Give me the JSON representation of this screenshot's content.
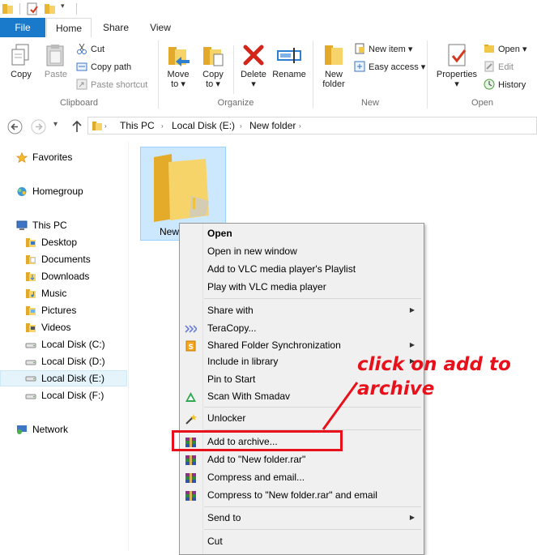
{
  "ribbon_tabs": [
    "File",
    "Home",
    "Share",
    "View"
  ],
  "clipboard": {
    "copy": "Copy",
    "paste": "Paste",
    "cut": "Cut",
    "copy_path": "Copy path",
    "paste_shortcut": "Paste shortcut",
    "group": "Clipboard"
  },
  "organize": {
    "move_to": [
      "Move",
      "to ▾"
    ],
    "copy_to": [
      "Copy",
      "to ▾"
    ],
    "delete": [
      "Delete",
      "▾"
    ],
    "rename": "Rename",
    "group": "Organize"
  },
  "new_group": {
    "new_folder": [
      "New",
      "folder"
    ],
    "new_item": "New item ▾",
    "easy_access": "Easy access ▾",
    "group": "New"
  },
  "open_group": {
    "properties": [
      "Properties",
      "▾"
    ],
    "open": "Open ▾",
    "edit": "Edit",
    "history": "History",
    "group": "Open"
  },
  "address": {
    "crumbs": [
      "This PC",
      "Local Disk (E:)",
      "New folder"
    ]
  },
  "nav": {
    "favorites": "Favorites",
    "homegroup": "Homegroup",
    "this_pc": "This PC",
    "items": [
      "Desktop",
      "Documents",
      "Downloads",
      "Music",
      "Pictures",
      "Videos",
      "Local Disk (C:)",
      "Local Disk (D:)",
      "Local Disk (E:)",
      "Local Disk (F:)"
    ],
    "network": "Network"
  },
  "folder_label": "New",
  "context_menu": {
    "open": "Open",
    "open_new_window": "Open in new window",
    "vlc_playlist": "Add to VLC media player's Playlist",
    "vlc_play": "Play with VLC media player",
    "share_with": "Share with",
    "teracopy": "TeraCopy...",
    "shared_sync": "Shared Folder Synchronization",
    "include_library": "Include in library",
    "pin_start": "Pin to Start",
    "smadav": "Scan With Smadav",
    "unlocker": "Unlocker",
    "add_archive": "Add to archive...",
    "add_rar": "Add to \"New folder.rar\"",
    "compress_email": "Compress and email...",
    "compress_rar_email": "Compress to \"New folder.rar\" and email",
    "send_to": "Send to",
    "cut": "Cut"
  },
  "annotation": [
    "click on add to",
    "archive"
  ],
  "colors": {
    "accent": "#1979ca",
    "annotation": "#e8101a",
    "selection": "#cce8ff"
  }
}
